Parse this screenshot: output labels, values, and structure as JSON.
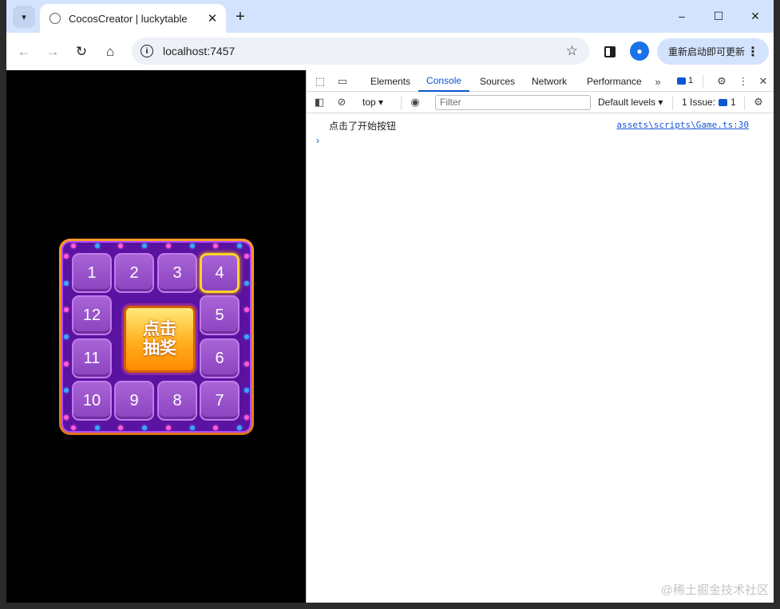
{
  "browser": {
    "tab_title": "CocosCreator | luckytable",
    "url": "localhost:7457",
    "update_button_label": "重新启动即可更新",
    "window_controls": {
      "minimize": "–",
      "maximize": "☐",
      "close": "✕"
    }
  },
  "game": {
    "cells": [
      "1",
      "2",
      "3",
      "4",
      "5",
      "6",
      "7",
      "8",
      "9",
      "10",
      "11",
      "12"
    ],
    "active_cell": "4",
    "center_button_label": "点击\n抽奖",
    "led_colors": [
      "#ff5ad9",
      "#39a6ff"
    ]
  },
  "devtools": {
    "tabs": [
      "Elements",
      "Console",
      "Sources",
      "Network",
      "Performance"
    ],
    "active_tab": "Console",
    "message_count": "1",
    "context": "top",
    "filter_placeholder": "Filter",
    "levels_label": "Default levels",
    "issues_label": "1 Issue:",
    "issues_count": "1",
    "log": {
      "message": "点击了开始按钮",
      "source": "assets\\scripts\\Game.ts:30"
    },
    "prompt_symbol": "›"
  },
  "watermark": "@稀土掘金技术社区"
}
